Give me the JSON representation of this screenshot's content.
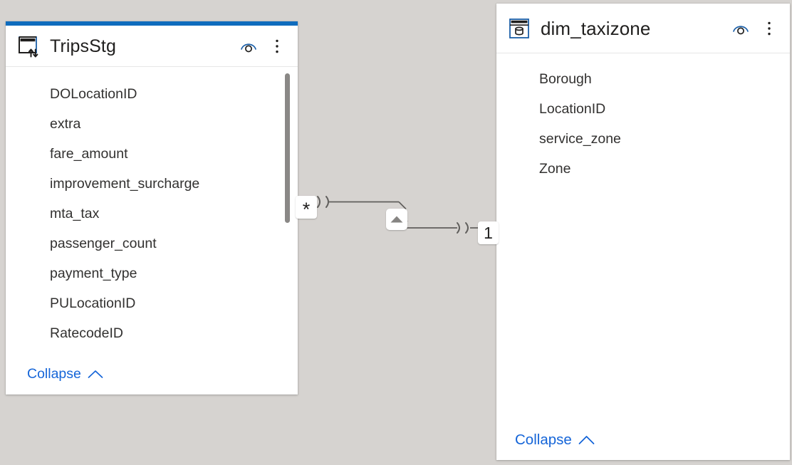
{
  "canvas": {
    "background": "#d6d3d0",
    "accent_color": "#0f6cbd",
    "link_color": "#1565d8"
  },
  "tables": [
    {
      "id": "tripsstg",
      "title": "TripsStg",
      "icon": "staging-table-icon",
      "selected": true,
      "accent": "#0f6cbd",
      "actions": [
        {
          "name": "hide-fields-icon",
          "label": "Hide fields"
        },
        {
          "name": "more-options-icon",
          "label": "More options"
        }
      ],
      "fields": [
        "DOLocationID",
        "extra",
        "fare_amount",
        "improvement_surcharge",
        "mta_tax",
        "passenger_count",
        "payment_type",
        "PULocationID",
        "RatecodeID"
      ],
      "has_scrollbar": true,
      "footer_label": "Collapse"
    },
    {
      "id": "dim_taxizone",
      "title": "dim_taxizone",
      "icon": "database-table-icon",
      "selected": false,
      "actions": [
        {
          "name": "hide-fields-icon",
          "label": "Hide fields"
        },
        {
          "name": "more-options-icon",
          "label": "More options"
        }
      ],
      "fields": [
        "Borough",
        "LocationID",
        "service_zone",
        "Zone"
      ],
      "has_scrollbar": false,
      "footer_label": "Collapse"
    }
  ],
  "relationship": {
    "from_table": "TripsStg",
    "to_table": "dim_taxizone",
    "from_cardinality": "*",
    "to_cardinality": "1",
    "cross_filter_direction": "single",
    "direction_icon": "filter-direction-arrow-icon",
    "line_color": "#605e5c"
  }
}
